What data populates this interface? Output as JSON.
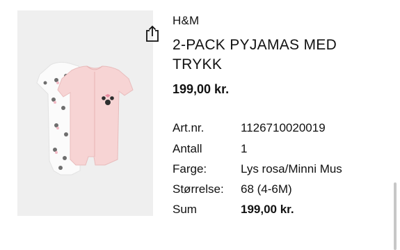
{
  "product": {
    "brand": "H&M",
    "title": "2-PACK PYJAMAS MED TRYKK",
    "price": "199,00 kr.",
    "image_alt": "Two baby rompers: white with Minnie Mouse print and light pink",
    "colors": {
      "background": "#efefef",
      "pink_romper": "#f7d4d4",
      "white_romper": "#fbfbfb"
    }
  },
  "share": {
    "icon": "share-icon"
  },
  "details": [
    {
      "label": "Art.nr.",
      "value": "1126710020019",
      "bold": false
    },
    {
      "label": "Antall",
      "value": "1",
      "bold": false
    },
    {
      "label": "Farge:",
      "value": "Lys rosa/Minni Mus",
      "bold": false
    },
    {
      "label": "Størrelse:",
      "value": "68 (4-6M)",
      "bold": false
    },
    {
      "label": "Sum",
      "value": "199,00 kr.",
      "bold": true
    }
  ]
}
